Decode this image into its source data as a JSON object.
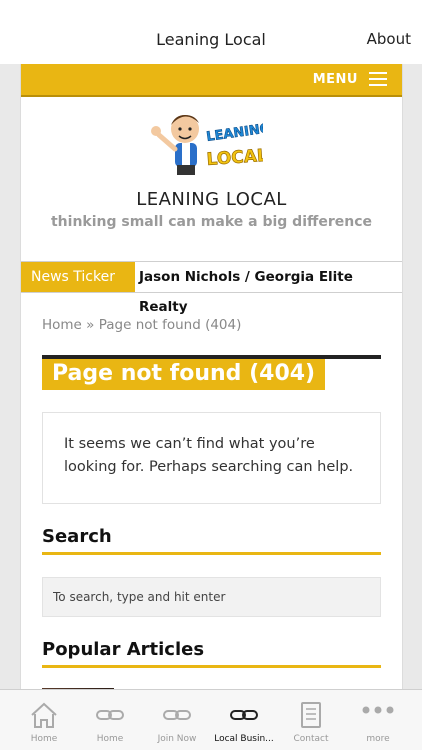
{
  "app": {
    "title": "Leaning Local",
    "about_label": "About"
  },
  "menu": {
    "label": "MENU"
  },
  "site": {
    "logo_text_top": "LEANING",
    "logo_text_bottom": "LOCAL",
    "title": "LEANING LOCAL",
    "tagline": "thinking small can make a big difference"
  },
  "ticker": {
    "label": "News Ticker",
    "item": "Jason Nichols / Georgia Elite Realty"
  },
  "breadcrumb": {
    "home": "Home",
    "separator": " » ",
    "current": "Page not found (404)"
  },
  "page": {
    "title": "Page not found (404)",
    "message": "It seems we can’t find what you’re looking for. Perhaps searching can help."
  },
  "search": {
    "heading": "Search",
    "placeholder": "To search, type and hit enter"
  },
  "popular": {
    "heading": "Popular Articles"
  },
  "tabs": [
    {
      "label": "Home",
      "icon": "home-icon"
    },
    {
      "label": "Home",
      "icon": "link-icon"
    },
    {
      "label": "Join Now",
      "icon": "link-icon"
    },
    {
      "label": "Local Busin...",
      "icon": "link-icon",
      "active": true
    },
    {
      "label": "Contact",
      "icon": "document-icon"
    },
    {
      "label": "more",
      "icon": "more-icon"
    }
  ],
  "colors": {
    "accent": "#e9b613",
    "text": "#222222",
    "muted": "#999999"
  }
}
